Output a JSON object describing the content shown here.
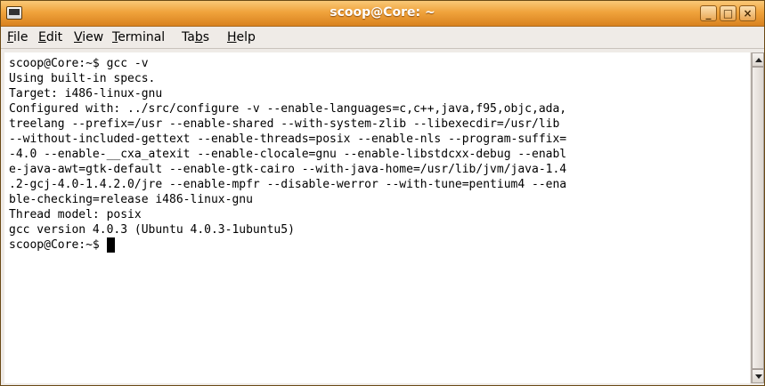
{
  "window": {
    "title": "scoop@Core: ~",
    "controls": {
      "minimize": "_",
      "maximize": "□",
      "close": "×"
    }
  },
  "menu": [
    {
      "pre": "",
      "mn": "F",
      "post": "ile"
    },
    {
      "pre": "",
      "mn": "E",
      "post": "dit"
    },
    {
      "pre": "",
      "mn": "V",
      "post": "iew"
    },
    {
      "pre": "",
      "mn": "T",
      "post": "erminal"
    },
    {
      "pre": "Ta",
      "mn": "b",
      "post": "s"
    },
    {
      "pre": "",
      "mn": "H",
      "post": "elp"
    }
  ],
  "terminal": {
    "lines": [
      "scoop@Core:~$ gcc -v",
      "Using built-in specs.",
      "Target: i486-linux-gnu",
      "Configured with: ../src/configure -v --enable-languages=c,c++,java,f95,objc,ada,",
      "treelang --prefix=/usr --enable-shared --with-system-zlib --libexecdir=/usr/lib",
      "--without-included-gettext --enable-threads=posix --enable-nls --program-suffix=",
      "-4.0 --enable-__cxa_atexit --enable-clocale=gnu --enable-libstdcxx-debug --enabl",
      "e-java-awt=gtk-default --enable-gtk-cairo --with-java-home=/usr/lib/jvm/java-1.4",
      ".2-gcj-4.0-1.4.2.0/jre --enable-mpfr --disable-werror --with-tune=pentium4 --ena",
      "ble-checking=release i486-linux-gnu",
      "Thread model: posix",
      "gcc version 4.0.3 (Ubuntu 4.0.3-1ubuntu5)"
    ],
    "prompt": "scoop@Core:~$ "
  }
}
